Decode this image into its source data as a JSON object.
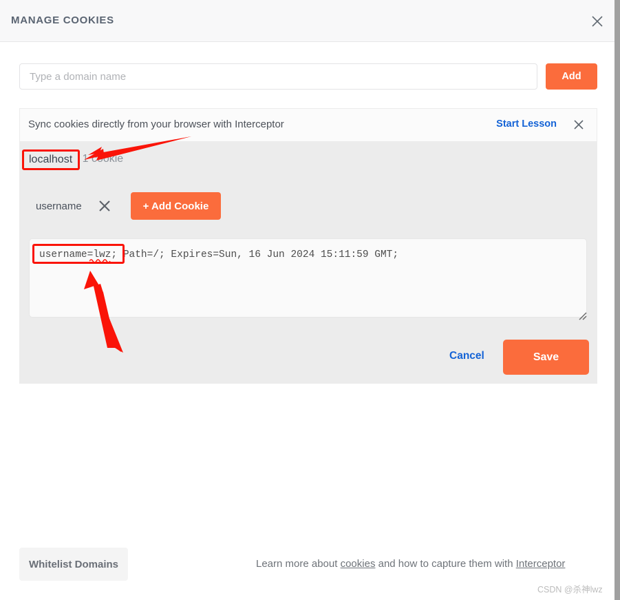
{
  "header": {
    "title": "MANAGE COOKIES",
    "close_icon": "close-icon"
  },
  "domain_bar": {
    "input_value": "",
    "input_placeholder": "Type a domain name",
    "add_label": "Add"
  },
  "sync_banner": {
    "text": "Sync cookies directly from your browser with Interceptor",
    "action_label": "Start Lesson",
    "close_icon": "close-icon"
  },
  "cookie_panel": {
    "domain_name": "localhost",
    "cookie_count": "1 cookie",
    "cookie_name": "username",
    "delete_icon": "close-icon",
    "add_cookie_label": "+ Add Cookie",
    "cookie_value": "username=lwz; Path=/; Expires=Sun, 16 Jun 2024 15:11:59 GMT;",
    "cancel_label": "Cancel",
    "save_label": "Save",
    "resize_handle_icon": "resize-grip-icon"
  },
  "footer": {
    "whitelist_label": "Whitelist Domains",
    "learn_more_prefix": "Learn more about ",
    "cookies_link": "cookies",
    "learn_more_middle": " and how to capture them with ",
    "interceptor_link": "Interceptor"
  },
  "watermark": {
    "text": "CSDN @杀神lwz"
  },
  "colors": {
    "accent_orange": "#fb6c3c",
    "link_blue": "#1463d6",
    "panel_grey": "#ececec",
    "header_grey": "#f8f8f9",
    "annotation_red": "#fa1408"
  }
}
